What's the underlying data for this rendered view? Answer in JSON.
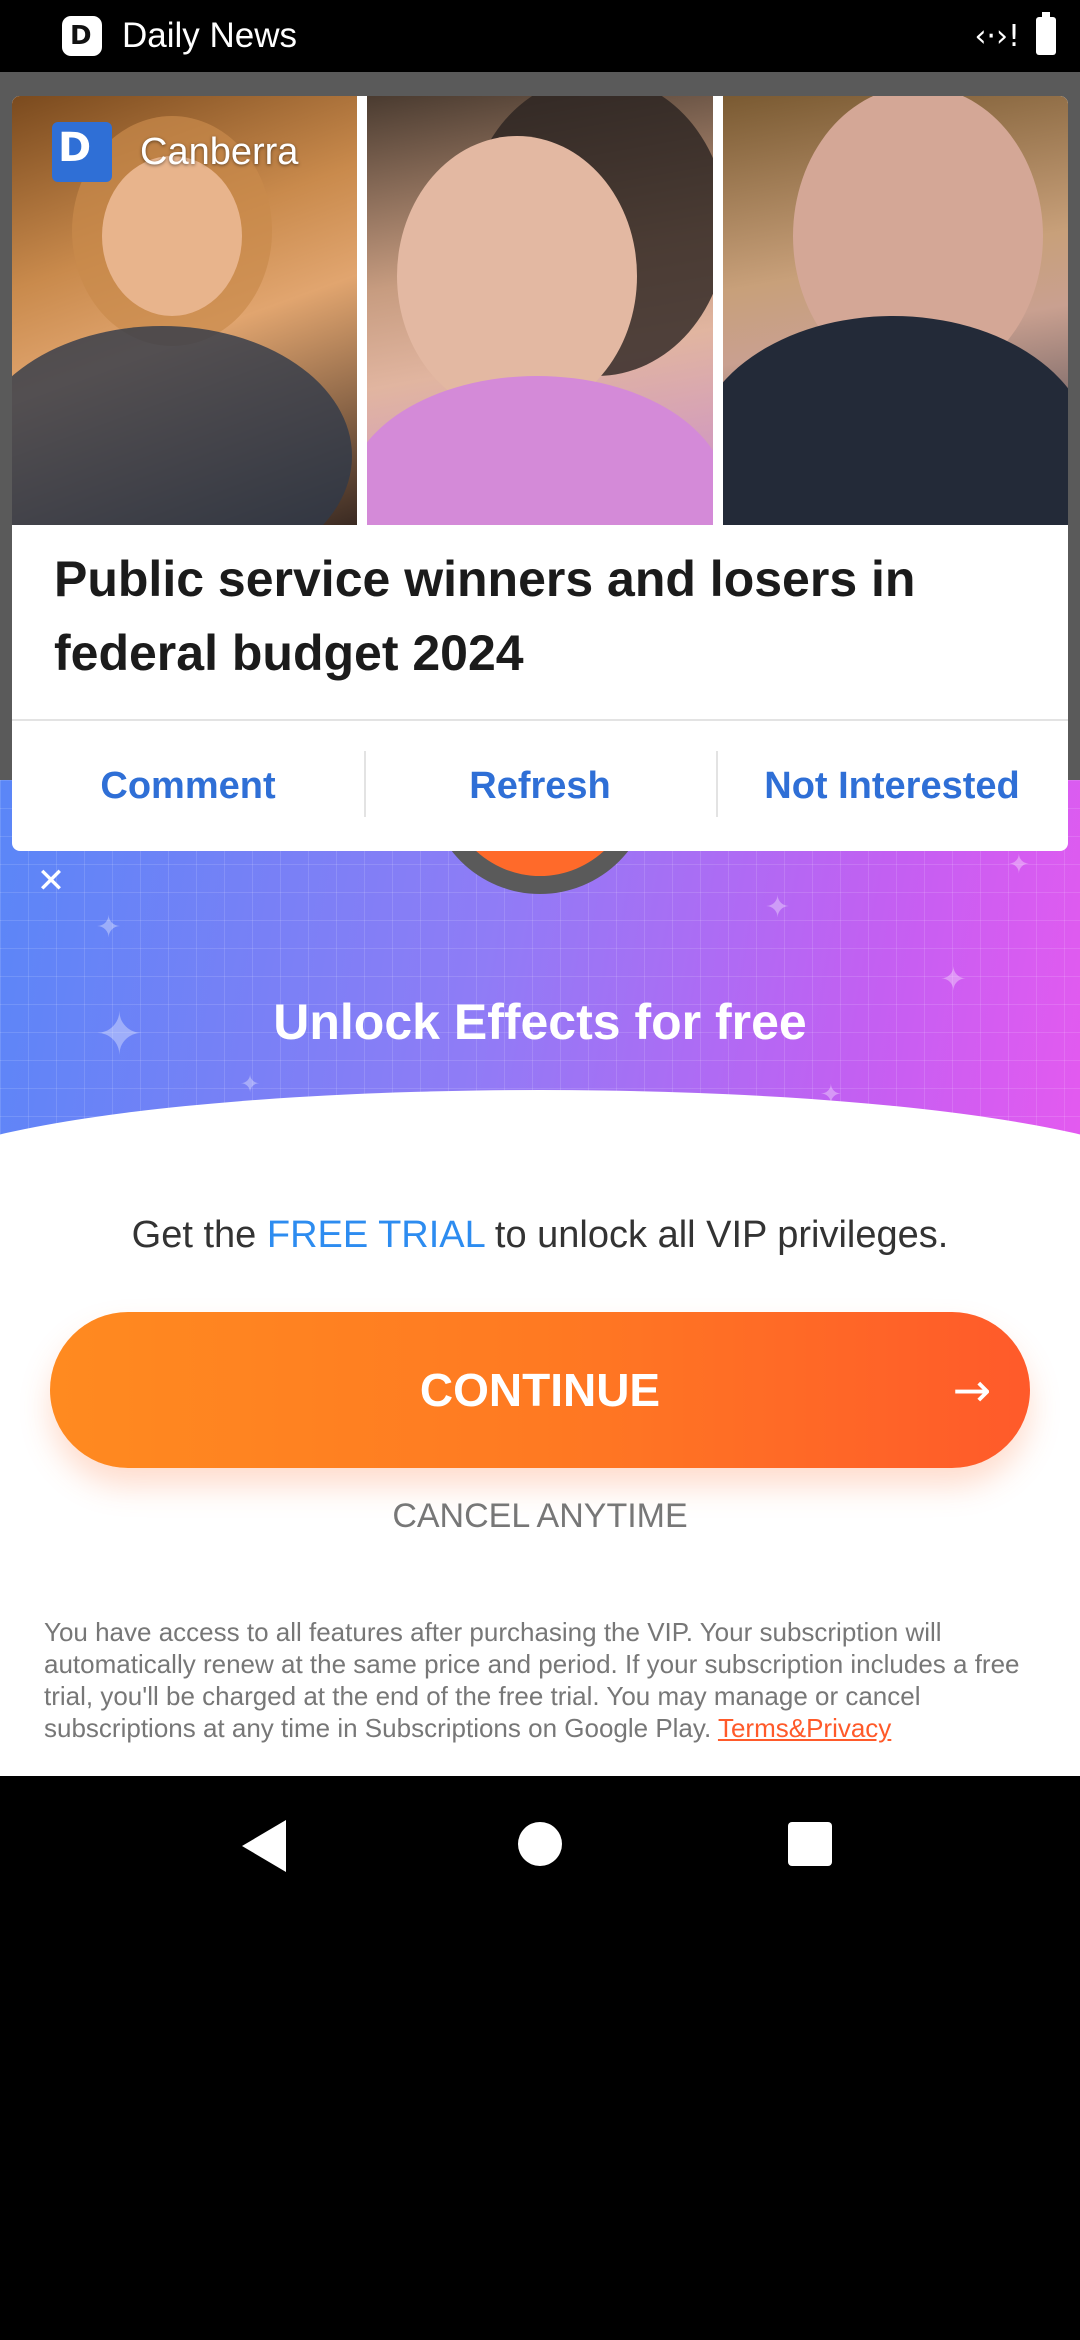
{
  "status_bar": {
    "app_name": "Daily News",
    "app_icon": "daily-news-icon",
    "signal_icon": "data-signal-icon",
    "battery_icon": "battery-icon"
  },
  "notification": {
    "source": "Canberra",
    "source_icon": "daily-news-logo-icon",
    "title": "Public service winners and losers in federal budget 2024",
    "actions": {
      "comment": "Comment",
      "refresh": "Refresh",
      "not_interested": "Not Interested"
    }
  },
  "paywall": {
    "headline": "Unlock Effects for free",
    "offer_prefix": "Get the ",
    "offer_highlight": "FREE TRIAL",
    "offer_suffix": " to unlock all VIP privileges.",
    "continue_label": "CONTINUE",
    "cancel_label": "CANCEL ANYTIME",
    "legal_text": "You have access to all features after purchasing the VIP. Your subscription will automatically renew at the same price and period. If your subscription includes a free trial, you'll be charged at the end of the free trial. You may manage or cancel subscriptions at any time in Subscriptions on Google Play. ",
    "terms_link": "Terms&Privacy",
    "colors": {
      "accent": "#ff6a2a",
      "highlight": "#2d8cf0",
      "link": "#2f6fd6"
    }
  },
  "nav_bar": {
    "back_icon": "back-triangle-icon",
    "home_icon": "home-circle-icon",
    "recents_icon": "recents-square-icon"
  }
}
